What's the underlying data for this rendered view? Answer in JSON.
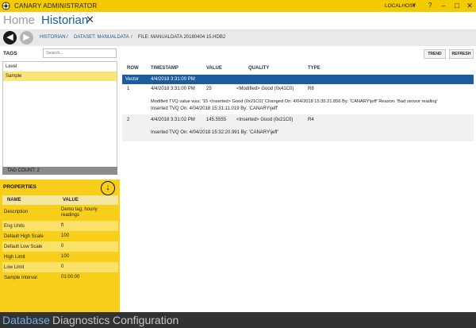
{
  "titlebar": {
    "app_title": "CANARY ADMINISTRATOR",
    "host": "LOCALHOST",
    "help": "?",
    "minimize": "–",
    "maximize": "□",
    "close": "✕",
    "colors": {
      "accent": "#f3c900"
    }
  },
  "tabs": {
    "home": "Home",
    "historian": "Historian",
    "close": "✕"
  },
  "breadcrumb": {
    "historian": "HISTORIAN",
    "sep": "/",
    "dataset": "DATASET: MANUALDATA",
    "file": "FILE: MANUALDATA 20180404 15.HDB2"
  },
  "tags": {
    "label": "TAGS",
    "search_placeholder": "Search...",
    "items": [
      {
        "label": "Level",
        "selected": false
      },
      {
        "label": "Sample",
        "selected": true
      }
    ],
    "count_label": "TAG COUNT: 2"
  },
  "properties": {
    "title": "PROPERTIES",
    "col_name": "NAME",
    "col_value": "VALUE",
    "rows": [
      {
        "name": "Description",
        "value": "Demo tag, hourly readings"
      },
      {
        "name": "Eng Units",
        "value": "ft"
      },
      {
        "name": "Default High Scale",
        "value": "100"
      },
      {
        "name": "Default Low Scale",
        "value": "0"
      },
      {
        "name": "High Limit",
        "value": "100"
      },
      {
        "name": "Low Limit",
        "value": "0"
      },
      {
        "name": "Sample Interval",
        "value": "01:00:00"
      }
    ]
  },
  "toolbar": {
    "trend": "TREND",
    "refresh": "REFRESH"
  },
  "grid": {
    "headers": {
      "row": "ROW",
      "timestamp": "TIMESTAMP",
      "value": "VALUE",
      "quality": "QUALITY",
      "type": "TYPE"
    },
    "group": {
      "name": "Vector",
      "timestamp": "4/4/2018 3:31:00 PM"
    },
    "records": [
      {
        "row": "1",
        "timestamp": "4/4/2018 3:31:00 PM",
        "value": "25",
        "quality": "<Modified> Good (0x41C0)",
        "type": "R8",
        "note1": "Modified TVQ value was: '15 <Inserted> Good (0x21C0)'  Changed On: 4/04/2018 15:35:21.856  By: 'CANARY\\jeff'  Reason: 'Bad sensor reading'",
        "note2": "Inserted TVQ  On: 4/04/2018 15:31:11.019  By: 'CANARY\\jeff'"
      },
      {
        "row": "2",
        "timestamp": "4/4/2018 3:31:02 PM",
        "value": "145.5555",
        "quality": "<Inserted> Good (0x21C0)",
        "type": "R4",
        "note1": "Inserted TVQ  On: 4/04/2018 15:32:20.991  By: 'CANARY\\jeff'"
      }
    ]
  },
  "bottom_nav": {
    "database": "Database",
    "diagnostics": "Diagnostics",
    "configuration": "Configuration"
  }
}
